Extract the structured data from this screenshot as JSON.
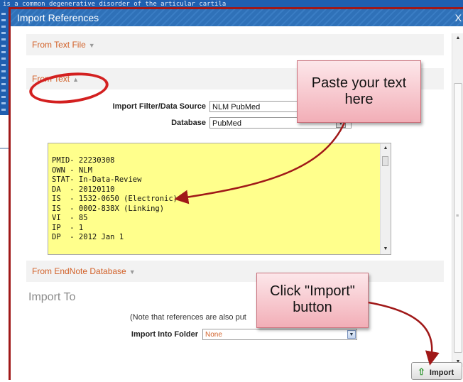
{
  "background": {
    "text_strip": "is a common degenerative disorder of the articular cartila"
  },
  "dialog": {
    "title": "Import References",
    "close": "X"
  },
  "sections": {
    "from_text_file": "From Text File",
    "from_text": "From Text",
    "from_endnote": "From EndNote Database"
  },
  "form": {
    "filter_label": "Import Filter/Data Source",
    "filter_value": "NLM PubMed",
    "database_label": "Database",
    "database_value": "PubMed",
    "import_text": "PMID- 22230308\nOWN - NLM\nSTAT- In-Data-Review\nDA  - 20120110\nIS  - 1532-0650 (Electronic)\nIS  - 0002-838X (Linking)\nVI  - 85\nIP  - 1\nDP  - 2012 Jan 1"
  },
  "import_to": {
    "heading": "Import To",
    "note": "(Note that references are also put",
    "folder_label": "Import Into Folder",
    "folder_value": "None"
  },
  "buttons": {
    "import": "Import"
  },
  "callouts": {
    "paste": "Paste your text here",
    "click": "Click \"Import\" button"
  },
  "icons": {
    "dropdown": "chevron-down-icon",
    "import": "up-arrow-icon",
    "collapse": "triangle-down-icon",
    "expand": "triangle-up-icon"
  },
  "colors": {
    "title_bar": "#2f71b8",
    "section_text": "#d2622a",
    "textarea_bg": "#ffff8c",
    "annotation": "#d32020"
  }
}
